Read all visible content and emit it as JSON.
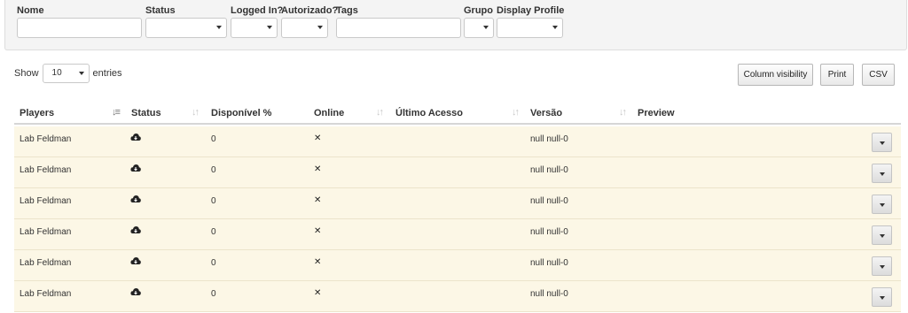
{
  "filters": {
    "nome_label": "Nome",
    "status_label": "Status",
    "logged_in_label": "Logged In?",
    "autorizado_label": "Autorizado?",
    "tags_label": "Tags",
    "grupo_label": "Grupo",
    "display_profile_label": "Display Profile"
  },
  "length_menu": {
    "show_label": "Show",
    "value": "10",
    "entries_label": "entries"
  },
  "buttons": {
    "column_visibility": "Column visibility",
    "print": "Print",
    "csv": "CSV"
  },
  "table": {
    "headers": {
      "players": "Players",
      "status": "Status",
      "disponivel": "Disponível %",
      "online": "Online",
      "ultimo_acesso": "Último Acesso",
      "versao": "Versão",
      "preview": "Preview"
    },
    "rows": [
      {
        "player": "Lab Feldman",
        "status_icon": "cloud-icon",
        "disponivel": "0",
        "online_icon": "x-icon",
        "ultimo_acesso": "",
        "versao": "null null-0"
      },
      {
        "player": "Lab Feldman",
        "status_icon": "cloud-icon",
        "disponivel": "0",
        "online_icon": "x-icon",
        "ultimo_acesso": "",
        "versao": "null null-0"
      },
      {
        "player": "Lab Feldman",
        "status_icon": "cloud-icon",
        "disponivel": "0",
        "online_icon": "x-icon",
        "ultimo_acesso": "",
        "versao": "null null-0"
      },
      {
        "player": "Lab Feldman",
        "status_icon": "cloud-icon",
        "disponivel": "0",
        "online_icon": "x-icon",
        "ultimo_acesso": "",
        "versao": "null null-0"
      },
      {
        "player": "Lab Feldman",
        "status_icon": "cloud-icon",
        "disponivel": "0",
        "online_icon": "x-icon",
        "ultimo_acesso": "",
        "versao": "null null-0"
      },
      {
        "player": "Lab Feldman",
        "status_icon": "cloud-icon",
        "disponivel": "0",
        "online_icon": "x-icon",
        "ultimo_acesso": "",
        "versao": "null null-0"
      }
    ]
  },
  "colors": {
    "row_background": "#fcf7e6",
    "filter_background": "#f4f4f4"
  }
}
